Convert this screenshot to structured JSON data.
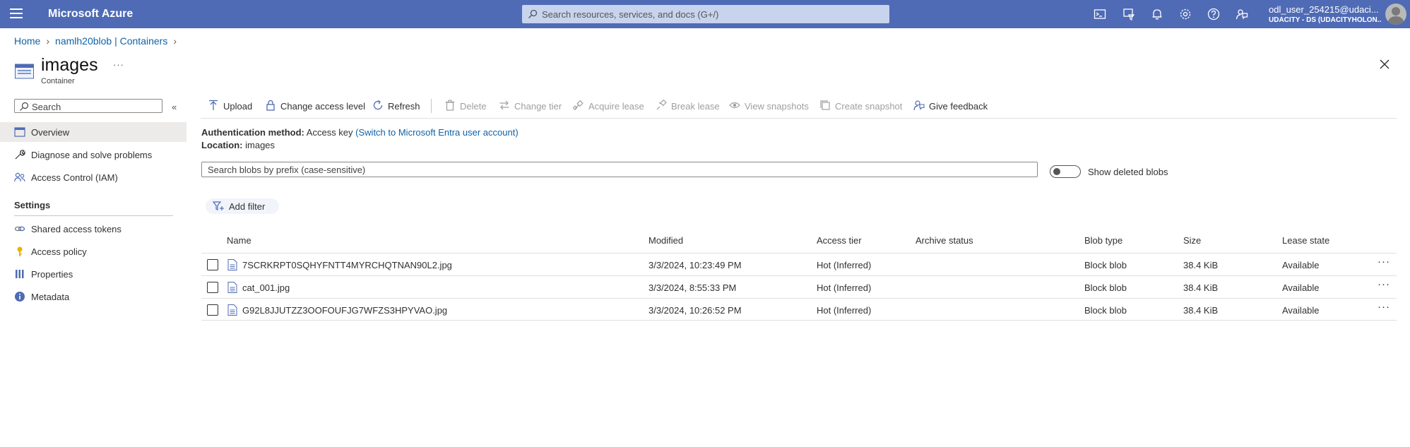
{
  "topbar": {
    "brand": "Microsoft Azure",
    "search_placeholder": "Search resources, services, and docs (G+/)",
    "user_name": "odl_user_254215@udaci...",
    "user_tenant": "UDACITY - DS (UDACITYHOLON..."
  },
  "breadcrumb": {
    "home": "Home",
    "container": "namlh20blob | Containers"
  },
  "title": {
    "name": "images",
    "subtitle": "Container",
    "more": "···"
  },
  "nav": {
    "search_placeholder": "Search",
    "collapse": "«",
    "items": [
      {
        "label": "Overview",
        "icon": "overview-icon"
      },
      {
        "label": "Diagnose and solve problems",
        "icon": "wrench-icon"
      },
      {
        "label": "Access Control (IAM)",
        "icon": "people-icon"
      }
    ],
    "settings_header": "Settings",
    "settings_items": [
      {
        "label": "Shared access tokens",
        "icon": "link-icon"
      },
      {
        "label": "Access policy",
        "icon": "key-icon"
      },
      {
        "label": "Properties",
        "icon": "properties-icon"
      },
      {
        "label": "Metadata",
        "icon": "info-icon"
      }
    ]
  },
  "toolbar": {
    "upload": "Upload",
    "change_access": "Change access level",
    "refresh": "Refresh",
    "delete": "Delete",
    "change_tier": "Change tier",
    "acquire_lease": "Acquire lease",
    "break_lease": "Break lease",
    "view_snapshots": "View snapshots",
    "create_snapshot": "Create snapshot",
    "give_feedback": "Give feedback"
  },
  "auth": {
    "method_label": "Authentication method:",
    "method_value": "Access key",
    "switch_link": "(Switch to Microsoft Entra user account)",
    "location_label": "Location:",
    "location_value": "images"
  },
  "blob_search": {
    "placeholder": "Search blobs by prefix (case-sensitive)",
    "toggle_label": "Show deleted blobs"
  },
  "filter": {
    "add_filter": "Add filter"
  },
  "table": {
    "headers": {
      "name": "Name",
      "modified": "Modified",
      "access_tier": "Access tier",
      "archive_status": "Archive status",
      "blob_type": "Blob type",
      "size": "Size",
      "lease_state": "Lease state"
    },
    "rows": [
      {
        "name": "7SCRKRPT0SQHYFNTT4MYRCHQTNAN90L2.jpg",
        "modified": "3/3/2024, 10:23:49 PM",
        "access_tier": "Hot (Inferred)",
        "archive_status": "",
        "blob_type": "Block blob",
        "size": "38.4 KiB",
        "lease_state": "Available"
      },
      {
        "name": "cat_001.jpg",
        "modified": "3/3/2024, 8:55:33 PM",
        "access_tier": "Hot (Inferred)",
        "archive_status": "",
        "blob_type": "Block blob",
        "size": "38.4 KiB",
        "lease_state": "Available"
      },
      {
        "name": "G92L8JJUTZZ3OOFOUFJG7WFZS3HPYVAO.jpg",
        "modified": "3/3/2024, 10:26:52 PM",
        "access_tier": "Hot (Inferred)",
        "archive_status": "",
        "blob_type": "Block blob",
        "size": "38.4 KiB",
        "lease_state": "Available"
      }
    ],
    "more": "···"
  },
  "colors": {
    "topbar": "#4f6bb5",
    "link": "#0f62a8",
    "active_nav": "#edebe9"
  }
}
